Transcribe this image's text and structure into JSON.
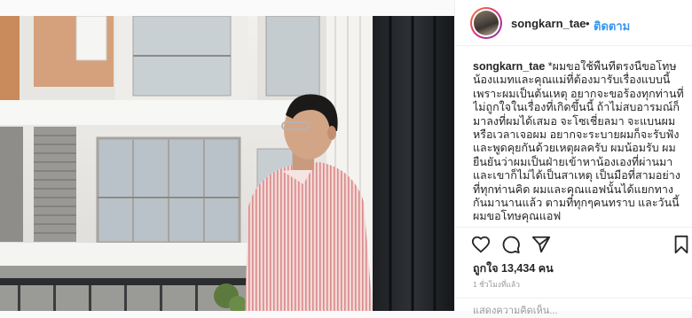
{
  "post": {
    "username": "songkarn_tae",
    "separator": "•",
    "follow_label": "ติดตาม",
    "caption_username": "songkarn_tae",
    "caption_text": " *ผมขอใช้พื้นที่ตรงนี้ขอโทษน้องแมทและคุณแม่ที่ต้องมารับเรื่องแบบนี้ เพราะผมเป็นต้นเหตุ อยากจะขอร้องทุกท่านที่ไม่ถูกใจในเรื่องที่เกิดขึ้นนี้ ถ้าไม่สบอารมณ์ก็มาลงที่ผมได้เสมอ จะโซเชี่ยลมา จะแบนผม หรือเวลาเจอผม อยากจะระบายผมก็จะรับฟังและพูดคุยกันด้วยเหตุผลครับ ผมน้อมรับ ผมยืนยันว่าผมเป็นฝ่ายเข้าหาน้องเองที่ผ่านมา และเขาก็ไม่ได้เป็นสาเหตุ เป็นมือที่สามอย่างที่ทุกท่านคิด ผมและคุณแอฟนั้นได้แยกทางกันมานานแล้ว ตามที่ทุกๆคนทราบ และวันนี้ผมขอโทษคุณแอฟ",
    "likes": "ถูกใจ 13,434 คน",
    "time": "1 ชั่วโมงที่แล้ว",
    "add_comment": "แสดงความคิดเห็น..."
  },
  "icons": {
    "like": "heart-icon",
    "comment": "comment-icon",
    "share": "share-icon",
    "save": "bookmark-icon"
  },
  "colors": {
    "follow": "#3897f0",
    "text": "#262626",
    "muted": "#999999"
  }
}
